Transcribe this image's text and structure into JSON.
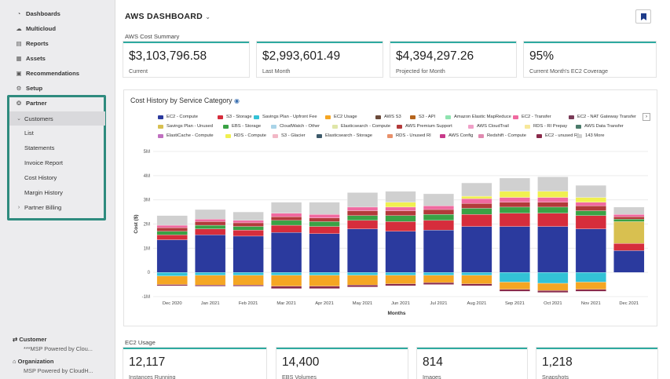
{
  "sidebar": {
    "items": [
      {
        "label": "Dashboards",
        "icon": "dashboard-icon",
        "glyph": "◔"
      },
      {
        "label": "Multicloud",
        "icon": "cloud-icon",
        "glyph": "☁"
      },
      {
        "label": "Reports",
        "icon": "reports-icon",
        "glyph": "▤"
      },
      {
        "label": "Assets",
        "icon": "assets-icon",
        "glyph": "▦"
      },
      {
        "label": "Recommendations",
        "icon": "recommendations-icon",
        "glyph": "▣"
      },
      {
        "label": "Setup",
        "icon": "gear-icon",
        "glyph": "⚙"
      },
      {
        "label": "Partner",
        "icon": "partner-icon",
        "glyph": "❂"
      }
    ],
    "customers_label": "Customers",
    "sub_items": [
      "List",
      "Statements",
      "Invoice Report",
      "Cost History",
      "Margin History"
    ],
    "partner_billing": "Partner Billing",
    "customer": {
      "title": "Customer",
      "value": "***MSP Powered by Clou..."
    },
    "organization": {
      "title": "Organization",
      "value": "MSP Powered by CloudH..."
    }
  },
  "header": {
    "title": "AWS DASHBOARD",
    "chevron": "⌄"
  },
  "cost_summary": {
    "label": "AWS Cost Summary",
    "cards": [
      {
        "value": "$3,103,796.58",
        "label": "Current"
      },
      {
        "value": "$2,993,601.49",
        "label": "Last Month"
      },
      {
        "value": "$4,394,297.26",
        "label": "Projected for Month"
      },
      {
        "value": "95%",
        "label": "Current Month's EC2 Coverage"
      }
    ]
  },
  "ec2_usage": {
    "label": "EC2 Usage",
    "cards": [
      {
        "value": "12,117",
        "label": "Instances Running"
      },
      {
        "value": "14,400",
        "label": "EBS Volumes"
      },
      {
        "value": "814",
        "label": "Images"
      },
      {
        "value": "1,218",
        "label": "Snapshots"
      }
    ]
  },
  "colors": {
    "accent": "#2eaaa0",
    "partner_box": "#2e8b7e"
  },
  "chart_data": {
    "type": "bar",
    "title": "Cost History by Service Category",
    "xlabel": "Months",
    "ylabel": "Cost ($)",
    "ylim": [
      -1,
      5
    ],
    "yticks": [
      "5M",
      "4M",
      "3M",
      "2M",
      "1M",
      "0",
      "-1M"
    ],
    "categories": [
      "Dec 2020",
      "Jan 2021",
      "Feb 2021",
      "Mar 2021",
      "Apr 2021",
      "May 2021",
      "Jun 2021",
      "Jul 2021",
      "Aug 2021",
      "Sep 2021",
      "Oct 2021",
      "Nov 2021",
      "Dec 2021"
    ],
    "legend": [
      {
        "name": "EC2 - Compute",
        "color": "#2b3a9e"
      },
      {
        "name": "S3 - Storage",
        "color": "#d62d3c"
      },
      {
        "name": "Savings Plan - Upfront Fee",
        "color": "#33c2d6"
      },
      {
        "name": "EC2 Usage",
        "color": "#f5a623"
      },
      {
        "name": "AWS S3",
        "color": "#6b4a3a"
      },
      {
        "name": "S3 - API",
        "color": "#b5651d"
      },
      {
        "name": "Amazon Elastic MapReduce",
        "color": "#8fe3b0"
      },
      {
        "name": "EC2 - Transfer",
        "color": "#f06aa0"
      },
      {
        "name": "EC2 - NAT Gateway Transfer",
        "color": "#7a3b58"
      },
      {
        "name": "Savings Plan - Unused",
        "color": "#d8c050"
      },
      {
        "name": "EBS - Storage",
        "color": "#3aa245"
      },
      {
        "name": "CloudWatch - Other",
        "color": "#a9d4e8"
      },
      {
        "name": "Elasticsearch - Compute",
        "color": "#dfe6a8"
      },
      {
        "name": "AWS Premium Support",
        "color": "#b33a3a"
      },
      {
        "name": "AWS CloudTrail",
        "color": "#f0a0c8"
      },
      {
        "name": "RDS - RI Prepay",
        "color": "#f7e89a"
      },
      {
        "name": "AWS Data Transfer",
        "color": "#4a7a6a"
      },
      {
        "name": "ElastiCache - Compute",
        "color": "#c070c0"
      },
      {
        "name": "RDS - Compute",
        "color": "#f0f050"
      },
      {
        "name": "S3 - Glacier",
        "color": "#f2b8c6"
      },
      {
        "name": "Elasticsearch - Storage",
        "color": "#3d5a6a"
      },
      {
        "name": "RDS - Unused RI",
        "color": "#e8906a"
      },
      {
        "name": "AWS Config",
        "color": "#c83a8a"
      },
      {
        "name": "Redshift - Compute",
        "color": "#e08ab0"
      },
      {
        "name": "EC2 - unused RI",
        "color": "#8a2a4a"
      },
      {
        "name": "143 More",
        "color": "#d0d0d0"
      }
    ],
    "series": [
      {
        "name": "EC2 - Compute",
        "color": "#2b3a9e",
        "values": [
          1.35,
          1.55,
          1.5,
          1.65,
          1.6,
          1.8,
          1.7,
          1.75,
          1.9,
          1.9,
          1.9,
          1.8,
          0.9
        ]
      },
      {
        "name": "S3 - Storage",
        "color": "#d62d3c",
        "values": [
          0.2,
          0.25,
          0.25,
          0.3,
          0.3,
          0.35,
          0.4,
          0.4,
          0.5,
          0.55,
          0.55,
          0.55,
          0.3
        ]
      },
      {
        "name": "Savings Plan - Unused",
        "color": "#d8c050",
        "values": [
          0,
          0,
          0,
          0,
          0,
          0,
          0,
          0,
          0,
          0,
          0,
          0,
          0.9
        ]
      },
      {
        "name": "EBS - Storage",
        "color": "#3aa245",
        "values": [
          0.15,
          0.15,
          0.15,
          0.2,
          0.2,
          0.2,
          0.25,
          0.25,
          0.25,
          0.25,
          0.25,
          0.2,
          0.1
        ]
      },
      {
        "name": "AWS Premium Support",
        "color": "#b33a3a",
        "values": [
          0.15,
          0.15,
          0.15,
          0.15,
          0.15,
          0.2,
          0.2,
          0.2,
          0.2,
          0.2,
          0.2,
          0.2,
          0.1
        ]
      },
      {
        "name": "EC2 - Transfer",
        "color": "#f06aa0",
        "values": [
          0.1,
          0.1,
          0.1,
          0.15,
          0.15,
          0.15,
          0.15,
          0.15,
          0.2,
          0.2,
          0.2,
          0.15,
          0.1
        ]
      },
      {
        "name": "RDS - Compute",
        "color": "#f0f050",
        "values": [
          0,
          0,
          0,
          0,
          0,
          0,
          0.2,
          0,
          0.1,
          0.25,
          0.25,
          0.2,
          0
        ]
      },
      {
        "name": "143 More",
        "color": "#d0d0d0",
        "values": [
          0.4,
          0.4,
          0.35,
          0.45,
          0.5,
          0.6,
          0.45,
          0.5,
          0.55,
          0.55,
          0.6,
          0.5,
          0.3
        ]
      },
      {
        "name": "Savings Plan - Upfront Fee",
        "color": "#33c2d6",
        "values": [
          -0.15,
          -0.12,
          -0.12,
          -0.12,
          -0.12,
          -0.12,
          -0.12,
          -0.12,
          -0.12,
          -0.4,
          -0.45,
          -0.4,
          0
        ]
      },
      {
        "name": "EC2 Usage",
        "color": "#f5a623",
        "values": [
          -0.35,
          -0.4,
          -0.4,
          -0.45,
          -0.45,
          -0.4,
          -0.35,
          -0.3,
          -0.35,
          -0.3,
          -0.3,
          -0.3,
          0
        ]
      },
      {
        "name": "EC2 - unused RI",
        "color": "#8a2a4a",
        "values": [
          -0.05,
          -0.05,
          -0.05,
          -0.1,
          -0.1,
          -0.08,
          -0.08,
          -0.08,
          -0.08,
          -0.08,
          -0.08,
          -0.08,
          0
        ]
      }
    ]
  }
}
